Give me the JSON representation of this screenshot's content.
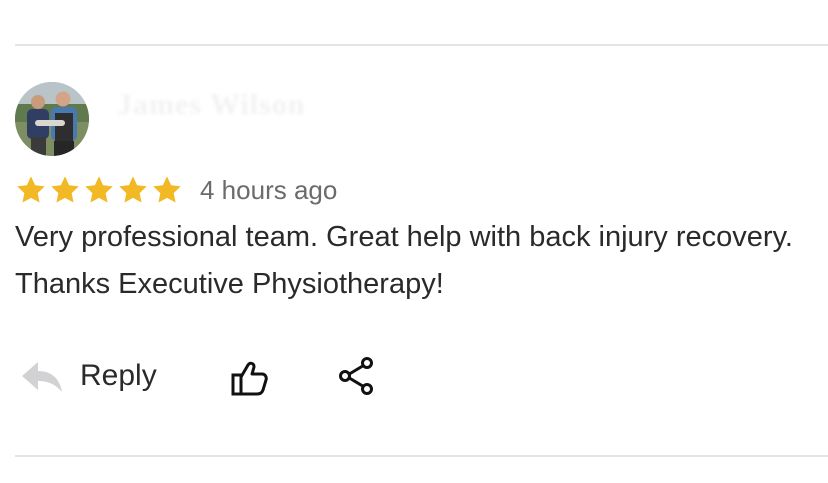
{
  "review": {
    "reviewer_name": "James Wilson",
    "rating": 5,
    "timestamp": "4 hours ago",
    "text": "Very professional team. Great help with back injury recovery. Thanks Executive Physiotherapy!"
  },
  "actions": {
    "reply_label": "Reply",
    "like_icon": "thumbs-up-icon",
    "share_icon": "share-icon",
    "reply_icon": "reply-arrow-icon"
  },
  "colors": {
    "star": "#f2b924",
    "divider": "#e4e4e6",
    "muted_text": "#6b6b6b",
    "reply_icon": "#d2d2d4"
  }
}
